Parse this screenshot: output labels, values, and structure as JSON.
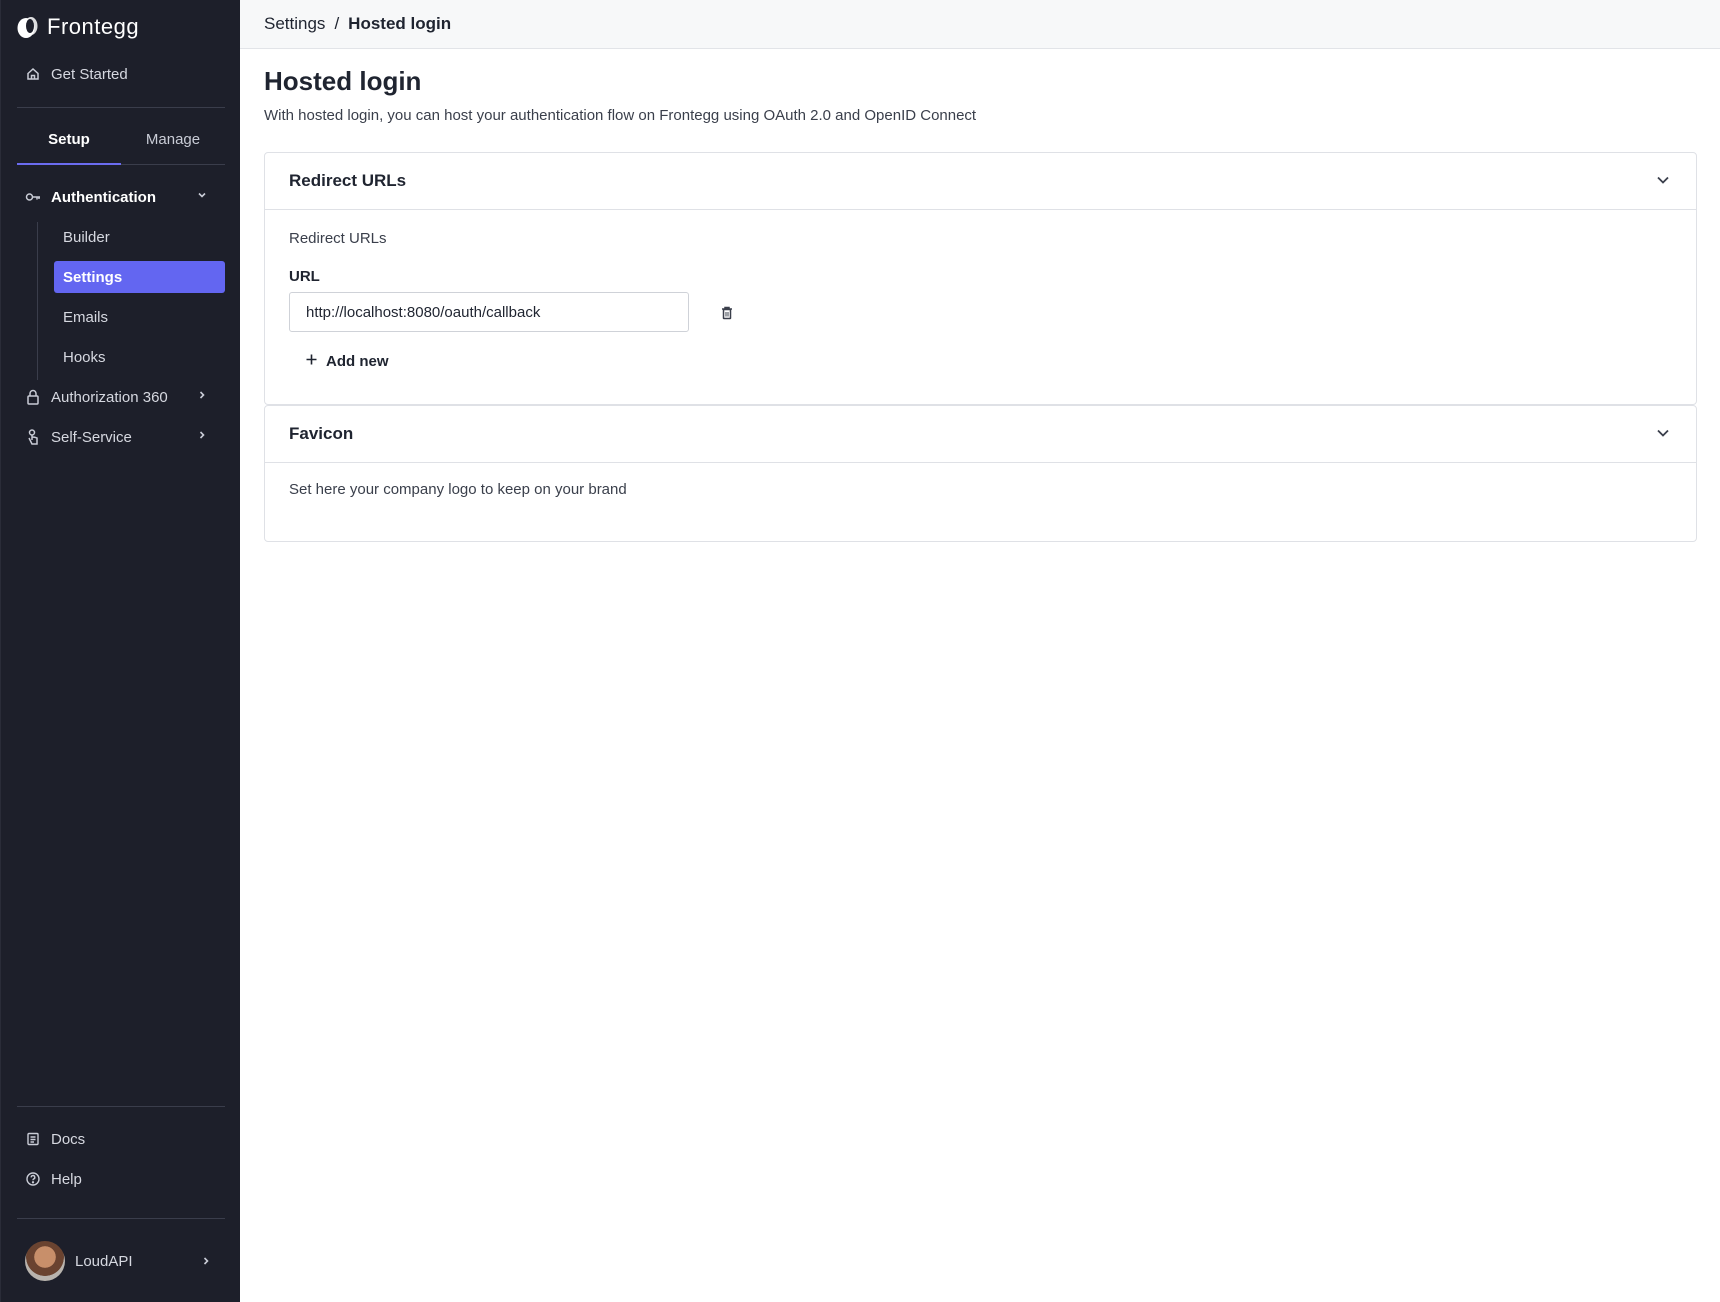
{
  "brand": {
    "name": "Frontegg"
  },
  "sidebar": {
    "get_started": "Get Started",
    "tabs": [
      "Setup",
      "Manage"
    ],
    "active_tab": "Setup",
    "authentication": "Authentication",
    "sub_items": [
      "Builder",
      "Settings",
      "Emails",
      "Hooks"
    ],
    "active_sub_item": "Settings",
    "authorization": "Authorization 360",
    "self_service": "Self-Service",
    "docs": "Docs",
    "help": "Help",
    "user": "LoudAPI"
  },
  "breadcrumb": {
    "parent": "Settings",
    "separator": "/",
    "current": "Hosted login"
  },
  "page": {
    "title": "Hosted login",
    "subtitle": "With hosted login, you can host your authentication flow on Frontegg using OAuth 2.0 and OpenID Connect"
  },
  "redirect_panel": {
    "title": "Redirect URLs",
    "caption": "Redirect URLs",
    "field_label": "URL",
    "url_value": "http://localhost:8080/oauth/callback",
    "add_new": "Add new"
  },
  "favicon_panel": {
    "title": "Favicon",
    "description": "Set here your company logo to keep on your brand"
  },
  "colors": {
    "accent": "#6366f1",
    "sidebar_bg": "#1d1f2a"
  },
  "icons": [
    "home-icon",
    "key-icon",
    "chevron-down-icon",
    "lock-icon",
    "chevron-right-icon",
    "hand-icon",
    "document-icon",
    "help-circle-icon",
    "trash-icon",
    "plus-icon"
  ]
}
